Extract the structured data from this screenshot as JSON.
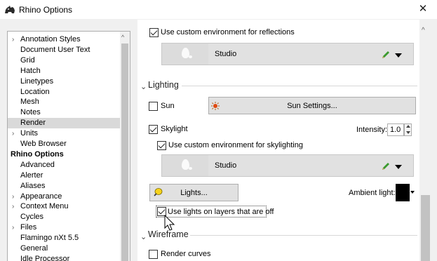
{
  "window": {
    "title": "Rhino Options",
    "close_glyph": "✕"
  },
  "tree": {
    "items": [
      {
        "label": "Annotation Styles",
        "arrow": "›",
        "root": false,
        "selected": false
      },
      {
        "label": "Document User Text",
        "arrow": "",
        "root": false,
        "selected": false
      },
      {
        "label": "Grid",
        "arrow": "",
        "root": false,
        "selected": false
      },
      {
        "label": "Hatch",
        "arrow": "",
        "root": false,
        "selected": false
      },
      {
        "label": "Linetypes",
        "arrow": "",
        "root": false,
        "selected": false
      },
      {
        "label": "Location",
        "arrow": "",
        "root": false,
        "selected": false
      },
      {
        "label": "Mesh",
        "arrow": "",
        "root": false,
        "selected": false
      },
      {
        "label": "Notes",
        "arrow": "",
        "root": false,
        "selected": false
      },
      {
        "label": "Render",
        "arrow": "",
        "root": false,
        "selected": true
      },
      {
        "label": "Units",
        "arrow": "›",
        "root": false,
        "selected": false
      },
      {
        "label": "Web Browser",
        "arrow": "",
        "root": false,
        "selected": false
      },
      {
        "label": "Rhino Options",
        "arrow": "",
        "root": true,
        "selected": false
      },
      {
        "label": "Advanced",
        "arrow": "",
        "root": false,
        "selected": false
      },
      {
        "label": "Alerter",
        "arrow": "",
        "root": false,
        "selected": false
      },
      {
        "label": "Aliases",
        "arrow": "",
        "root": false,
        "selected": false
      },
      {
        "label": "Appearance",
        "arrow": "›",
        "root": false,
        "selected": false
      },
      {
        "label": "Context Menu",
        "arrow": "›",
        "root": false,
        "selected": false
      },
      {
        "label": "Cycles",
        "arrow": "",
        "root": false,
        "selected": false
      },
      {
        "label": "Files",
        "arrow": "›",
        "root": false,
        "selected": false
      },
      {
        "label": "Flamingo nXt 5.5",
        "arrow": "",
        "root": false,
        "selected": false
      },
      {
        "label": "General",
        "arrow": "",
        "root": false,
        "selected": false
      },
      {
        "label": "Idle Processor",
        "arrow": "",
        "root": false,
        "selected": false
      }
    ],
    "scroll_up_glyph": "^"
  },
  "panel": {
    "scroll_up_glyph": "^",
    "reflection": {
      "checkbox_label": "Use custom environment for reflections",
      "checked": true,
      "environment_name": "Studio"
    },
    "lighting": {
      "header": "Lighting",
      "chevron": "⌄",
      "sun": {
        "label": "Sun",
        "checked": false,
        "button_label": "Sun Settings..."
      },
      "skylight": {
        "label": "Skylight",
        "checked": true,
        "intensity_label": "Intensity:",
        "intensity_value": "1.0"
      },
      "skylight_env": {
        "checkbox_label": "Use custom environment for skylighting",
        "checked": true,
        "environment_name": "Studio"
      },
      "lights_button_label": "Lights...",
      "ambient_label": "Ambient light:",
      "ambient_color": "#000000",
      "lights_off_layers": {
        "label": "Use lights on layers that are off",
        "checked": true
      }
    },
    "wireframe": {
      "header": "Wireframe",
      "chevron": "⌄",
      "render_curves": {
        "label": "Render curves",
        "checked": false
      }
    }
  }
}
